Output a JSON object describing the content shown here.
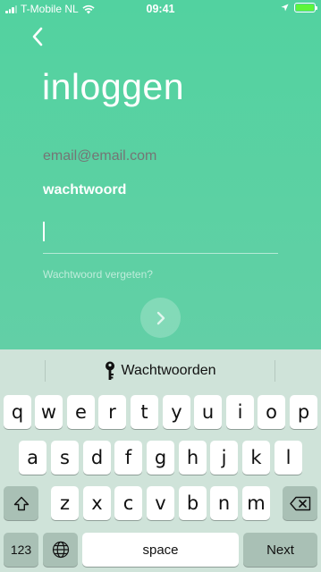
{
  "status_bar": {
    "carrier": "T-Mobile NL",
    "time": "09:41"
  },
  "login": {
    "title": "inloggen",
    "email_placeholder": "email@email.com",
    "password_label": "wachtwoord",
    "forgot_link": "Wachtwoord vergeten?"
  },
  "keyboard": {
    "suggestion": "Wachtwoorden",
    "row1": [
      "q",
      "w",
      "e",
      "r",
      "t",
      "y",
      "u",
      "i",
      "o",
      "p"
    ],
    "row2": [
      "a",
      "s",
      "d",
      "f",
      "g",
      "h",
      "j",
      "k",
      "l"
    ],
    "row3": [
      "z",
      "x",
      "c",
      "v",
      "b",
      "n",
      "m"
    ],
    "numbers_label": "123",
    "space_label": "space",
    "return_label": "Next"
  },
  "colors": {
    "background": "#5cd1a3",
    "keyboard_bg": "#cfe3d9",
    "battery": "#5ef53a"
  }
}
